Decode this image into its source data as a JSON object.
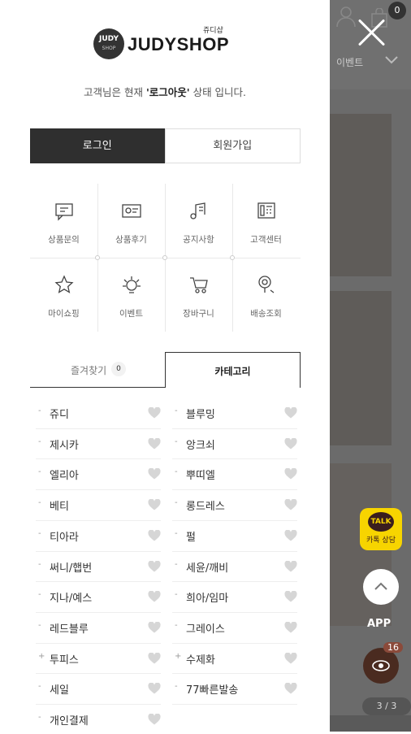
{
  "logo": {
    "circle_top": "JUDY",
    "circle_bottom": "SHOP",
    "korean": "쥬디샵",
    "text": "JUDYSHOP"
  },
  "status": {
    "prefix": "고객님은 현재 ",
    "highlight": "'로그아웃'",
    "suffix": " 상태 입니다."
  },
  "auth": {
    "login": "로그인",
    "join": "회원가입"
  },
  "menu": [
    {
      "label": "상품문의",
      "icon": "chat-icon"
    },
    {
      "label": "상품후기",
      "icon": "review-icon"
    },
    {
      "label": "공지사항",
      "icon": "notice-icon"
    },
    {
      "label": "고객센터",
      "icon": "phone-icon"
    },
    {
      "label": "마이쇼핑",
      "icon": "star-icon"
    },
    {
      "label": "이벤트",
      "icon": "event-icon"
    },
    {
      "label": "장바구니",
      "icon": "cart-icon"
    },
    {
      "label": "배송조회",
      "icon": "delivery-icon"
    }
  ],
  "tabs": {
    "favorites": "즐겨찾기",
    "favorites_count": "0",
    "category": "카테고리"
  },
  "categories": [
    {
      "left": {
        "bullet": "-",
        "label": "쥬디"
      },
      "right": {
        "bullet": "-",
        "label": "블루밍"
      }
    },
    {
      "left": {
        "bullet": "-",
        "label": "제시카"
      },
      "right": {
        "bullet": "-",
        "label": "앙크쇠"
      }
    },
    {
      "left": {
        "bullet": "-",
        "label": "엘리아"
      },
      "right": {
        "bullet": "-",
        "label": "뿌띠엘"
      }
    },
    {
      "left": {
        "bullet": "-",
        "label": "베티"
      },
      "right": {
        "bullet": "-",
        "label": "롱드레스"
      }
    },
    {
      "left": {
        "bullet": "-",
        "label": "티아라"
      },
      "right": {
        "bullet": "-",
        "label": "펄"
      }
    },
    {
      "left": {
        "bullet": "-",
        "label": "써니/햅번"
      },
      "right": {
        "bullet": "-",
        "label": "세윤/깨비"
      }
    },
    {
      "left": {
        "bullet": "-",
        "label": "지나/예스"
      },
      "right": {
        "bullet": "-",
        "label": "희아/임마"
      }
    },
    {
      "left": {
        "bullet": "-",
        "label": "레드블루"
      },
      "right": {
        "bullet": "-",
        "label": "그레이스"
      }
    },
    {
      "left": {
        "bullet": "+",
        "label": "투피스"
      },
      "right": {
        "bullet": "+",
        "label": "수제화"
      }
    },
    {
      "left": {
        "bullet": "-",
        "label": "세일"
      },
      "right": {
        "bullet": "-",
        "label": "77빠른발송"
      }
    },
    {
      "left": {
        "bullet": "-",
        "label": "개인결제"
      },
      "right": null
    }
  ],
  "background": {
    "cart_count": "0",
    "nav_text": "이벤트",
    "talk_bubble": "TALK",
    "talk_label": "카톡 상담",
    "app_label": "APP",
    "eye_count": "16",
    "pager": "3 / 3"
  },
  "colors": {
    "dark": "#2f2f2f",
    "accent_yellow": "#f7d400"
  }
}
